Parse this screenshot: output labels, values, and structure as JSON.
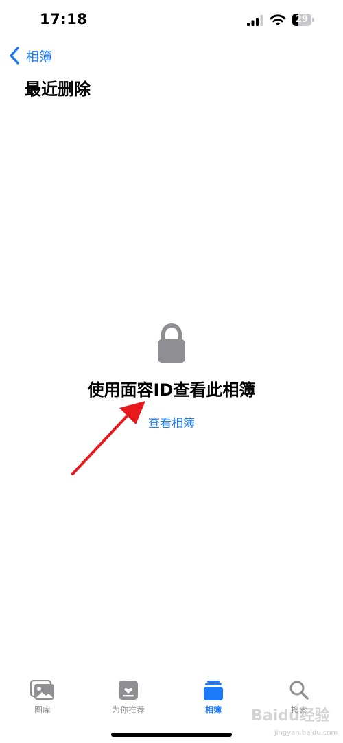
{
  "status_bar": {
    "time": "17:18",
    "battery_level": "29"
  },
  "nav": {
    "back_label": "相簿"
  },
  "page": {
    "title": "最近删除",
    "lock_message": "使用面容ID查看此相簿",
    "view_link": "查看相簿"
  },
  "tabs": [
    {
      "label": "图库",
      "icon": "photo-library-icon"
    },
    {
      "label": "为你推荐",
      "icon": "for-you-icon"
    },
    {
      "label": "相簿",
      "icon": "albums-icon",
      "active": true
    },
    {
      "label": "搜索",
      "icon": "search-icon"
    }
  ],
  "watermark": {
    "text": "Baidu经验",
    "url": "jingyan.baidu.com"
  },
  "colors": {
    "accent": "#1a7af8",
    "arrow": "#e8191c",
    "icon_gray": "#8e8e93"
  }
}
